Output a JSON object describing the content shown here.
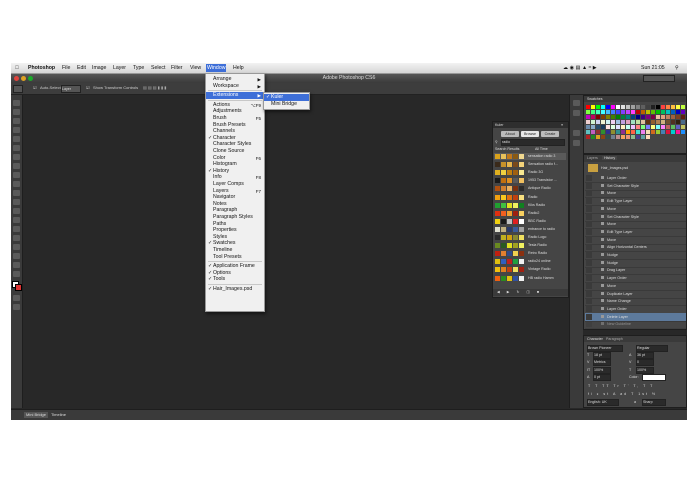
{
  "menubar": {
    "app": "Photoshop",
    "items": [
      "File",
      "Edit",
      "Image",
      "Layer",
      "Type",
      "Select",
      "Filter",
      "View",
      "Window",
      "Help"
    ],
    "active": "Window",
    "clock": "Sun 21:05"
  },
  "titlebar": {
    "title": "Adobe Photoshop CS6"
  },
  "options_bar": {
    "auto_select": "Auto-Select:",
    "auto_select_value": "Layer",
    "transform": "Show Transform Controls"
  },
  "window_menu": {
    "items": [
      {
        "label": "Arrange",
        "check": "",
        "shortcut": "▶"
      },
      {
        "label": "Workspace",
        "check": "",
        "shortcut": "▶"
      },
      {
        "sep": true
      },
      {
        "label": "Extensions",
        "check": "",
        "shortcut": "▶",
        "selected": true
      },
      {
        "sep": true
      },
      {
        "label": "Actions",
        "check": "",
        "shortcut": "⌥F9"
      },
      {
        "label": "Adjustments",
        "check": "",
        "shortcut": ""
      },
      {
        "label": "Brush",
        "check": "",
        "shortcut": "F5"
      },
      {
        "label": "Brush Presets",
        "check": "",
        "shortcut": ""
      },
      {
        "label": "Channels",
        "check": "",
        "shortcut": ""
      },
      {
        "label": "Character",
        "check": "✓",
        "shortcut": ""
      },
      {
        "label": "Character Styles",
        "check": "",
        "shortcut": ""
      },
      {
        "label": "Clone Source",
        "check": "",
        "shortcut": ""
      },
      {
        "label": "Color",
        "check": "",
        "shortcut": "F6"
      },
      {
        "label": "Histogram",
        "check": "",
        "shortcut": ""
      },
      {
        "label": "History",
        "check": "✓",
        "shortcut": ""
      },
      {
        "label": "Info",
        "check": "",
        "shortcut": "F8"
      },
      {
        "label": "Layer Comps",
        "check": "",
        "shortcut": ""
      },
      {
        "label": "Layers",
        "check": "",
        "shortcut": "F7"
      },
      {
        "label": "Navigator",
        "check": "",
        "shortcut": ""
      },
      {
        "label": "Notes",
        "check": "",
        "shortcut": ""
      },
      {
        "label": "Paragraph",
        "check": "",
        "shortcut": ""
      },
      {
        "label": "Paragraph Styles",
        "check": "",
        "shortcut": ""
      },
      {
        "label": "Paths",
        "check": "",
        "shortcut": ""
      },
      {
        "label": "Properties",
        "check": "",
        "shortcut": ""
      },
      {
        "label": "Styles",
        "check": "",
        "shortcut": ""
      },
      {
        "label": "Swatches",
        "check": "✓",
        "shortcut": ""
      },
      {
        "label": "Timeline",
        "check": "",
        "shortcut": ""
      },
      {
        "label": "Tool Presets",
        "check": "",
        "shortcut": ""
      },
      {
        "sep": true
      },
      {
        "label": "Application Frame",
        "check": "✓",
        "shortcut": ""
      },
      {
        "label": "Options",
        "check": "✓",
        "shortcut": ""
      },
      {
        "label": "Tools",
        "check": "✓",
        "shortcut": ""
      },
      {
        "sep": true
      },
      {
        "label": "Hair_Images.psd",
        "check": "✓",
        "shortcut": ""
      }
    ]
  },
  "extensions_submenu": {
    "items": [
      {
        "label": "Kuler",
        "check": "✓",
        "selected": true
      },
      {
        "label": "Mini Bridge",
        "check": "",
        "selected": false
      }
    ]
  },
  "kuler_panel": {
    "title": "Kuler",
    "tabs": [
      "About",
      "Browse",
      "Create"
    ],
    "search_value": "radio",
    "results_label": "Search Results",
    "time_filter": "All Time",
    "themes": [
      {
        "name": "sensation radio 3",
        "colors": [
          "#d9a21c",
          "#e8c15a",
          "#c0781a",
          "#8a5a12",
          "#f0d890"
        ]
      },
      {
        "name": "Sensation radio f...",
        "colors": [
          "#3a2a1a",
          "#c7922a",
          "#e6b54a",
          "#7a4a1a",
          "#f2d27a"
        ]
      },
      {
        "name": "Radio 3G",
        "colors": [
          "#e0b020",
          "#f0d040",
          "#c08010",
          "#a06010",
          "#f8e890"
        ]
      },
      {
        "name": "1953 Transistor ...",
        "colors": [
          "#1a1a1a",
          "#c07010",
          "#e09020",
          "#5a5a5a",
          "#f0c060"
        ]
      },
      {
        "name": "Antique Radio",
        "colors": [
          "#b05010",
          "#d08030",
          "#e8b060",
          "#7a3010",
          "#2a2a2a"
        ]
      },
      {
        "name": "Radio",
        "colors": [
          "#f0a010",
          "#f8c820",
          "#e07010",
          "#c04010",
          "#f8e080"
        ]
      },
      {
        "name": "Kiks Radio",
        "colors": [
          "#20a030",
          "#40c040",
          "#e0e020",
          "#f0f060",
          "#108020"
        ]
      },
      {
        "name": "Radio2",
        "colors": [
          "#e03010",
          "#f06020",
          "#f0a030",
          "#a02010",
          "#f8d060"
        ]
      },
      {
        "name": "BBC Radio",
        "colors": [
          "#f0d010",
          "#1a1a1a",
          "#c0c0c0",
          "#e02020",
          "#ffffff"
        ]
      },
      {
        "name": "entrance to radio",
        "colors": [
          "#e0e0d0",
          "#c0b080",
          "#2a3a6a",
          "#3a5a9a",
          "#a0a0a0"
        ]
      },
      {
        "name": "Radio Logo",
        "colors": [
          "#2a2a2a",
          "#c0b020",
          "#d0a010",
          "#8a8a30",
          "#f0e060"
        ]
      },
      {
        "name": "Tesla Radio",
        "colors": [
          "#6a8a20",
          "#2a5a20",
          "#e0e020",
          "#a0a020",
          "#f0f060"
        ]
      },
      {
        "name": "Retro Radio",
        "colors": [
          "#c02010",
          "#e08030",
          "#304a8a",
          "#f0d050",
          "#8a3010"
        ]
      },
      {
        "name": "radio24 online",
        "colors": [
          "#e0c010",
          "#3060c0",
          "#c02020",
          "#20a040",
          "#f0f0f0"
        ]
      },
      {
        "name": "Vintage Radio",
        "colors": [
          "#f0c010",
          "#e08020",
          "#c04010",
          "#f0e060",
          "#a02010"
        ]
      },
      {
        "name": "HB radio Hamm",
        "colors": [
          "#f06010",
          "#2a8a20",
          "#e0c010",
          "#3050a0",
          "#f0f0f0"
        ]
      }
    ]
  },
  "swatches_panel": {
    "title": "Swatches",
    "colors": [
      "#ff0000",
      "#ffff00",
      "#00ff00",
      "#00ffff",
      "#0000ff",
      "#ff00ff",
      "#ffffff",
      "#e0e0e0",
      "#c0c0c0",
      "#a0a0a0",
      "#808080",
      "#606060",
      "#404040",
      "#202020",
      "#000000",
      "#ff4040",
      "#ff8040",
      "#ffc040",
      "#ffff40",
      "#c0ff40",
      "#80ff40",
      "#40ff80",
      "#40ffc0",
      "#40ffff",
      "#40c0ff",
      "#4080ff",
      "#4040ff",
      "#8040ff",
      "#c040ff",
      "#ff40ff",
      "#c00000",
      "#c06000",
      "#c0c000",
      "#60c000",
      "#00c000",
      "#00c060",
      "#00c0c0",
      "#0060c0",
      "#0000c0",
      "#6000c0",
      "#c000c0",
      "#c00060",
      "#800000",
      "#804000",
      "#808000",
      "#408000",
      "#008000",
      "#008040",
      "#008080",
      "#004080",
      "#000080",
      "#400080",
      "#800080",
      "#800040",
      "#f0c0a0",
      "#e0a080",
      "#c08060",
      "#a06040",
      "#804020",
      "#602010",
      "#f0d0d0",
      "#d0f0d0",
      "#d0d0f0",
      "#f0f0d0",
      "#d0f0f0",
      "#f0d0f0",
      "#a0c0e0",
      "#c0a0e0",
      "#e0a0c0",
      "#a0e0c0",
      "#c0e0a0",
      "#e0c0a0",
      "#603010",
      "#906030",
      "#b08050",
      "#d0b080",
      "#705030",
      "#503020",
      "#302010",
      "#4a6a8a",
      "#6a8aaa",
      "#8aaaca",
      "#2a4a6a",
      "#1a3a5a",
      "#ffe0e0",
      "#e0ffe0",
      "#e0e0ff",
      "#fff0c0",
      "#c0fff0",
      "#f0c0ff",
      "#ff8080",
      "#80ff80",
      "#8080ff",
      "#ffff80",
      "#80ffff",
      "#ff80ff",
      "#c06060",
      "#60c060",
      "#6060c0",
      "#c0c060",
      "#60c0c0",
      "#c060c0",
      "#903030",
      "#309030",
      "#303090",
      "#909030",
      "#309090",
      "#903090",
      "#ffa500",
      "#ff6347",
      "#40e0d0",
      "#ee82ee",
      "#f5deb3",
      "#d2691e",
      "#9acd32",
      "#4682b4",
      "#dc143c",
      "#00ced1",
      "#ff1493",
      "#1e90ff",
      "#b22222",
      "#228b22",
      "#daa520",
      "#8b4513",
      "#2f4f4f",
      "#708090",
      "#bc8f8f",
      "#f4a460",
      "#e9967a",
      "#8fbc8f",
      "#483d8b",
      "#5f9ea0",
      "#ffdab9"
    ]
  },
  "history_panel": {
    "tabs": [
      "Layers",
      "History"
    ],
    "active_tab": "History",
    "snapshot": "Hair_Images.psd",
    "items": [
      "Layer Order",
      "Set Character Style",
      "Move",
      "Edit Type Layer",
      "Move",
      "Set Character Style",
      "Move",
      "Edit Type Layer",
      "Move",
      "Align Horizontal Centers",
      "Nudge",
      "Nudge",
      "Drag Layer",
      "Layer Order",
      "Move",
      "Duplicate Layer",
      "Name Change",
      "Layer Order",
      "Delete Layer",
      "New Guideline"
    ],
    "selected_index": 18
  },
  "character_panel": {
    "tabs": [
      "Character",
      "Paragraph"
    ],
    "font_family": "Brown Pioneer",
    "font_style": "Regular",
    "font_size": "18 pt",
    "leading": "36 pt",
    "kerning": "Metrics",
    "tracking": "0",
    "vscale": "100%",
    "hscale": "100%",
    "baseline": "0 pt",
    "color_label": "Color:",
    "language": "English: UK",
    "antialias": "Sharp",
    "aa_label": "a"
  },
  "bottom": {
    "tabs": [
      "Mini Bridge",
      "Timeline"
    ]
  }
}
